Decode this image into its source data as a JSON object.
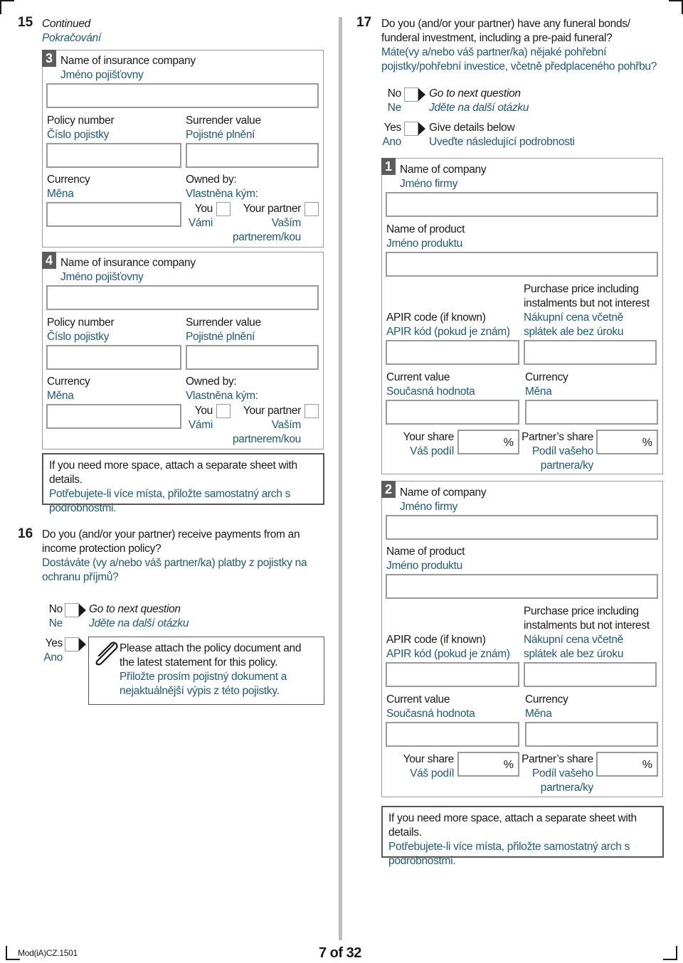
{
  "q15": {
    "number": "15",
    "continued_en": "Continued",
    "continued_cz": "Pokračování",
    "policies": [
      {
        "index": "3",
        "company_en": "Name of insurance company",
        "company_cz": "Jméno pojišťovny",
        "policy_en": "Policy number",
        "policy_cz": "Číslo pojistky",
        "surrender_en": "Surrender value",
        "surrender_cz": "Pojistné plnění",
        "currency_en": "Currency",
        "currency_cz": "Měna",
        "owned_en": "Owned by:",
        "owned_cz": "Vlastněna kým:",
        "you_en": "You",
        "you_cz": "Vámi",
        "partner_en": "Your partner",
        "partner_cz_1": "Vaším",
        "partner_cz_2": "partnerem/kou"
      },
      {
        "index": "4",
        "company_en": "Name of insurance company",
        "company_cz": "Jméno pojišťovny",
        "policy_en": "Policy number",
        "policy_cz": "Číslo pojistky",
        "surrender_en": "Surrender value",
        "surrender_cz": "Pojistné plnění",
        "currency_en": "Currency",
        "currency_cz": "Měna",
        "owned_en": "Owned by:",
        "owned_cz": "Vlastněna kým:",
        "you_en": "You",
        "you_cz": "Vámi",
        "partner_en": "Your partner",
        "partner_cz_1": "Vaším",
        "partner_cz_2": "partnerem/kou"
      }
    ],
    "note_en": "If you need more space, attach a separate sheet with details.",
    "note_cz_1": "Potřebujete-li více místa, přiložte samostatný arch s",
    "note_cz_2": "podrobnostmi."
  },
  "q16": {
    "number": "16",
    "question_en_1": "Do you (and/or your partner) receive payments from an",
    "question_en_2": "income protection policy?",
    "question_cz_1": "Dostáváte (vy a/nebo váš partner/ka) platby z pojistky na",
    "question_cz_2": "ochranu příjmů?",
    "no_en": "No",
    "no_cz": "Ne",
    "no_action_en": "Go to next question",
    "no_action_cz": "Jděte na další otázku",
    "yes_en": "Yes",
    "yes_cz": "Ano",
    "attach_en_1": "Please attach the policy document and",
    "attach_en_2": "the latest statement for this policy.",
    "attach_cz_1": "Přiložte prosím pojistný dokument a",
    "attach_cz_2": "nejaktuálnější výpis z této pojistky."
  },
  "q17": {
    "number": "17",
    "question_en_1": "Do you (and/or your partner) have any funeral bonds/",
    "question_en_2": "funderal investment, including a pre-paid funeral?",
    "question_cz_1": "Máte(vy a/nebo váš partner/ka) nějaké pohřební",
    "question_cz_2": "pojistky/pohřební investice, včetně předplaceného pohřbu?",
    "no_en": "No",
    "no_cz": "Ne",
    "no_action_en": "Go to next question",
    "no_action_cz": "Jděte na další otázku",
    "yes_en": "Yes",
    "yes_cz": "Ano",
    "yes_action_en": "Give details below",
    "yes_action_cz": "Uveďte následující podrobnosti",
    "items": [
      {
        "index": "1",
        "company_en": "Name of company",
        "company_cz": "Jméno firmy",
        "product_en": "Name of product",
        "product_cz": "Jméno produktu",
        "apir_en": "APIR code (if known)",
        "apir_cz": "APIR kód (pokud je znám)",
        "price_en_1": "Purchase price including",
        "price_en_2": "instalments but not interest",
        "price_cz_1": "Nákupní cena včetně",
        "price_cz_2": "splátek ale bez úroku",
        "current_en": "Current value",
        "current_cz": "Současná hodnota",
        "currency_en": "Currency",
        "currency_cz": "Měna",
        "your_share_en": "Your share",
        "your_share_cz": "Váš podíl",
        "partner_share_en": "Partner’s share",
        "partner_share_cz_1": "Podíl vašeho",
        "partner_share_cz_2": "partnera/ky",
        "percent": "%"
      },
      {
        "index": "2",
        "company_en": "Name of company",
        "company_cz": "Jméno firmy",
        "product_en": "Name of product",
        "product_cz": "Jméno produktu",
        "apir_en": "APIR code (if known)",
        "apir_cz": "APIR kód (pokud je znám)",
        "price_en_1": "Purchase price including",
        "price_en_2": "instalments but not interest",
        "price_cz_1": "Nákupní cena včetně",
        "price_cz_2": "splátek ale bez úroku",
        "current_en": "Current value",
        "current_cz": "Současná hodnota",
        "currency_en": "Currency",
        "currency_cz": "Měna",
        "your_share_en": "Your share",
        "your_share_cz": "Váš podíl",
        "partner_share_en": "Partner’s share",
        "partner_share_cz_1": "Podíl vašeho",
        "partner_share_cz_2": "partnera/ky",
        "percent": "%"
      }
    ],
    "note_en": "If you need more space, attach a separate sheet with details.",
    "note_cz_1": "Potřebujete-li více místa, přiložte samostatný arch s",
    "note_cz_2": "podrobnostmi."
  },
  "footer": {
    "form_code": "Mod(iA)CZ.1501",
    "page": "7 of 32"
  },
  "colors": {
    "czech_text": "#1f5a7a",
    "badge": "#5c5c5c",
    "border": "#9a9a9a"
  }
}
